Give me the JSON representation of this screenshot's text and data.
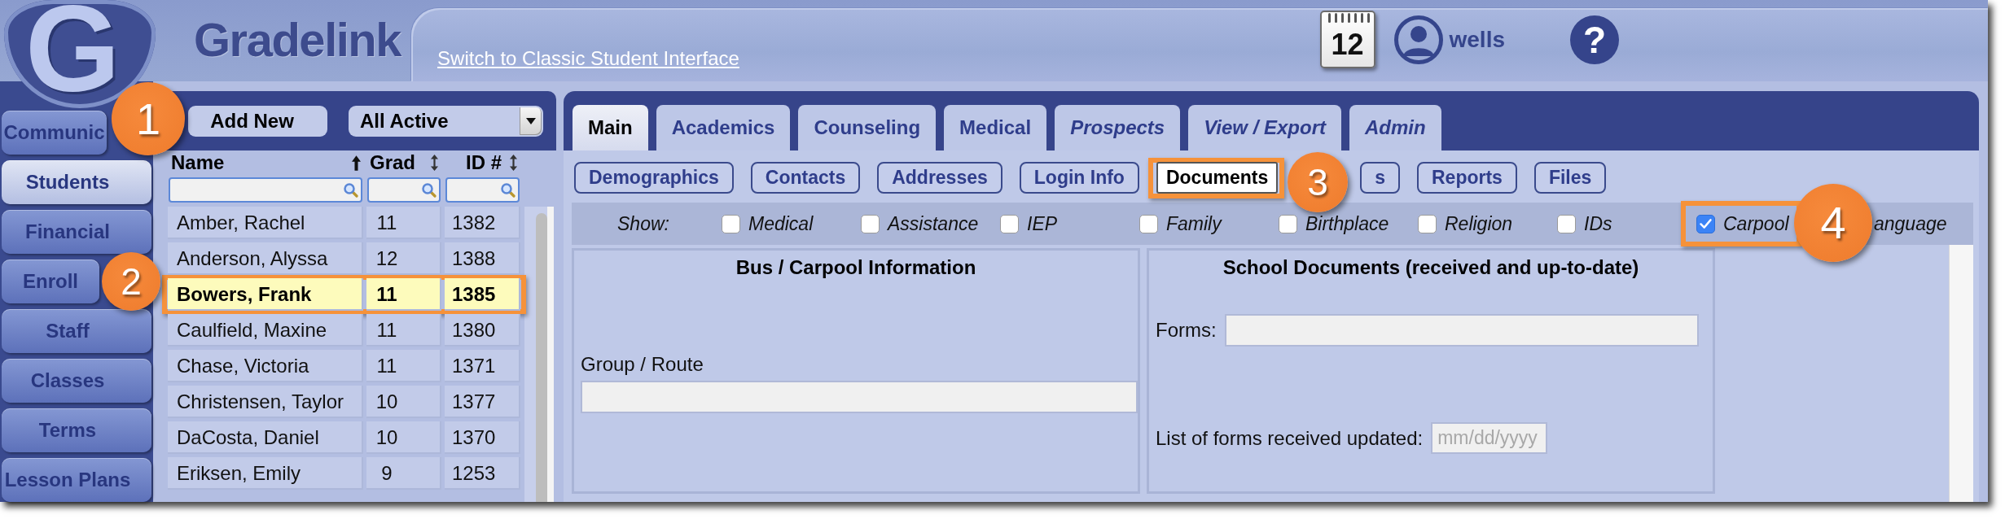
{
  "header": {
    "logo_letter": "G",
    "brand": "Gradelink",
    "classic_link": "Switch to Classic Student Interface",
    "calendar_day": "12",
    "username": "wells",
    "help": "?"
  },
  "nav": [
    {
      "label": "Communic",
      "selected": false
    },
    {
      "label": "Students",
      "selected": true
    },
    {
      "label": "Financial",
      "selected": false
    },
    {
      "label": "Enroll",
      "selected": false
    },
    {
      "label": "Staff",
      "selected": false
    },
    {
      "label": "Classes",
      "selected": false
    },
    {
      "label": "Terms",
      "selected": false
    },
    {
      "label": "Lesson Plans",
      "selected": false
    }
  ],
  "student_list": {
    "add_button": "Add New",
    "filter": "All Active",
    "columns": [
      {
        "label": "Name",
        "kind": "ascending"
      },
      {
        "label": "Grad",
        "kind": "sortable"
      },
      {
        "label": "ID #",
        "kind": "sortable"
      }
    ],
    "rows": [
      {
        "cells": [
          "Amber, Rachel",
          "11",
          "1382"
        ],
        "selected": false,
        "highlighted": false
      },
      {
        "cells": [
          "Anderson, Alyssa",
          "12",
          "1388"
        ],
        "selected": false,
        "highlighted": false
      },
      {
        "cells": [
          "Bowers, Frank",
          "11",
          "1385"
        ],
        "selected": true,
        "highlighted": true
      },
      {
        "cells": [
          "Caulfield, Maxine",
          "11",
          "1380"
        ],
        "selected": false,
        "highlighted": false
      },
      {
        "cells": [
          "Chase, Victoria",
          "11",
          "1371"
        ],
        "selected": false,
        "highlighted": false
      },
      {
        "cells": [
          "Christensen, Taylor",
          "10",
          "1377"
        ],
        "selected": false,
        "highlighted": false
      },
      {
        "cells": [
          "DaCosta, Daniel",
          "10",
          "1370"
        ],
        "selected": false,
        "highlighted": false
      },
      {
        "cells": [
          "Eriksen, Emily",
          "9",
          "1253"
        ],
        "selected": false,
        "highlighted": false
      }
    ]
  },
  "tabs": [
    {
      "label": "Main",
      "selected": true,
      "italic": false
    },
    {
      "label": "Academics",
      "selected": false,
      "italic": false
    },
    {
      "label": "Counseling",
      "selected": false,
      "italic": false
    },
    {
      "label": "Medical",
      "selected": false,
      "italic": false
    },
    {
      "label": "Prospects",
      "selected": false,
      "italic": true
    },
    {
      "label": "View / Export",
      "selected": false,
      "italic": true
    },
    {
      "label": "Admin",
      "selected": false,
      "italic": true
    }
  ],
  "subtabs": [
    {
      "label": "Demographics",
      "selected": false,
      "highlighted": false
    },
    {
      "label": "Contacts",
      "selected": false,
      "highlighted": false
    },
    {
      "label": "Addresses",
      "selected": false,
      "highlighted": false
    },
    {
      "label": "Login Info",
      "selected": false,
      "highlighted": false
    },
    {
      "label": "Documents",
      "selected": true,
      "highlighted": true
    },
    {
      "label": "s",
      "selected": false,
      "highlighted": false
    },
    {
      "label": "Reports",
      "selected": false,
      "highlighted": false
    },
    {
      "label": "Files",
      "selected": false,
      "highlighted": false
    }
  ],
  "show_bar": {
    "label": "Show:",
    "options": [
      {
        "kind": "checkbox",
        "label": "Medical",
        "checked": false,
        "highlighted": false
      },
      {
        "kind": "checkbox",
        "label": "Assistance",
        "checked": false,
        "highlighted": false
      },
      {
        "kind": "checkbox",
        "label": "IEP",
        "checked": false,
        "highlighted": false
      },
      {
        "kind": "checkbox",
        "label": "Family",
        "checked": false,
        "highlighted": false
      },
      {
        "kind": "checkbox",
        "label": "Birthplace",
        "checked": false,
        "highlighted": false
      },
      {
        "kind": "checkbox",
        "label": "Religion",
        "checked": false,
        "highlighted": false
      },
      {
        "kind": "checkbox",
        "label": "IDs",
        "checked": false,
        "highlighted": false
      },
      {
        "kind": "checkbox",
        "label": "Carpool",
        "checked": true,
        "highlighted": true
      },
      {
        "kind": "text",
        "label": "anguage",
        "highlighted": false
      }
    ]
  },
  "sections": [
    {
      "title": "Bus / Carpool Information",
      "fields": [
        {
          "kind": "stacked",
          "label": "Group / Route"
        }
      ]
    },
    {
      "title": "School Documents (received and up-to-date)",
      "fields": [
        {
          "kind": "inline",
          "label": "Forms:"
        },
        {
          "kind": "date",
          "label": "List of forms received updated:",
          "placeholder": "mm/dd/yyyy"
        }
      ]
    }
  ],
  "callouts": [
    {
      "number": "1"
    },
    {
      "number": "2"
    },
    {
      "number": "3"
    },
    {
      "number": "4"
    }
  ]
}
